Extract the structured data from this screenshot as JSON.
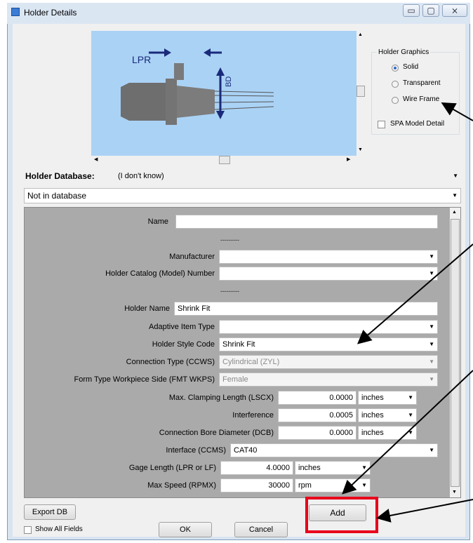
{
  "window": {
    "title": "Holder Details",
    "minimize": "▭",
    "maximize": "▢",
    "close": "⨯"
  },
  "graphics": {
    "lpr_label": "LPR",
    "bd_label": "BD",
    "group_title": "Holder Graphics",
    "options": [
      "Solid",
      "Transparent",
      "Wire Frame"
    ],
    "selected": "Solid",
    "spa_label": "SPA Model Detail"
  },
  "database": {
    "label": "Holder Database:",
    "value": "(I don't know)",
    "status": "Not in database"
  },
  "fields": {
    "name_label": "Name",
    "name_value": "",
    "separator": "---------",
    "manufacturer_label": "Manufacturer",
    "manufacturer_value": "",
    "catalog_label": "Holder Catalog (Model) Number",
    "catalog_value": "",
    "holder_name_label": "Holder Name",
    "holder_name_value": "Shrink Fit",
    "adaptive_label": "Adaptive Item Type",
    "adaptive_value": "",
    "style_label": "Holder Style Code",
    "style_value": "Shrink Fit",
    "connection_label": "Connection Type (CCWS)",
    "connection_value": "Cylindrical (ZYL)",
    "form_label": "Form Type Workpiece Side (FMT WKPS)",
    "form_value": "Female",
    "clamp_label": "Max. Clamping Length (LSCX)",
    "clamp_value": "0.0000",
    "clamp_unit": "inches",
    "interference_label": "Interference",
    "interference_value": "0.0005",
    "interference_unit": "inches",
    "bore_label": "Connection Bore Diameter (DCB)",
    "bore_value": "0.0000",
    "bore_unit": "inches",
    "interface_label": "Interface (CCMS)",
    "interface_value": "CAT40",
    "gage_label": "Gage Length (LPR or LF)",
    "gage_value": "4.0000",
    "gage_unit": "inches",
    "speed_label": "Max Speed (RPMX)",
    "speed_value": "30000",
    "speed_unit": "rpm"
  },
  "buttons": {
    "export": "Export DB",
    "add": "Add",
    "ok": "OK",
    "cancel": "Cancel",
    "show_all": "Show All Fields"
  },
  "colors": {
    "graphic_bg": "#aad2f5",
    "holder": "#6e6e6e",
    "arrow": "#1a2a7a",
    "highlight": "#e8001c"
  }
}
